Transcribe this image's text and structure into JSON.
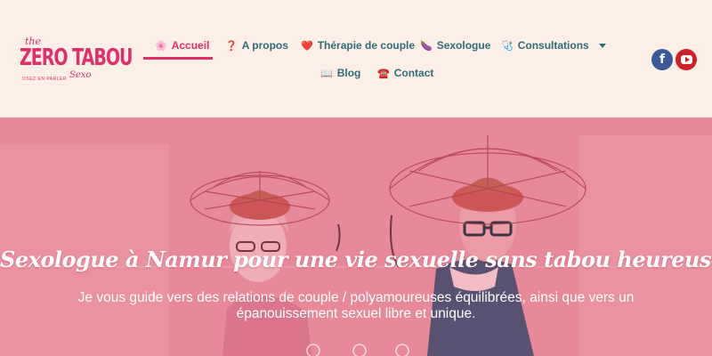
{
  "logo": {
    "small_word": "the",
    "main_word": "ZERO TABOU",
    "tagline": "OSEZ EN PARLER",
    "script_word": "Sexo"
  },
  "nav": {
    "items": [
      {
        "emoji": "🌸",
        "label": "Accueil",
        "active": true
      },
      {
        "emoji": "❓",
        "label": "A propos"
      },
      {
        "emoji": "❤️",
        "label": "Thérapie de couple"
      },
      {
        "emoji": "🍆",
        "label": "Sexologue"
      },
      {
        "emoji": "🩺",
        "label": "Consultations",
        "has_dropdown": true
      },
      {
        "emoji": "📖",
        "label": "Blog"
      },
      {
        "emoji": "☎️",
        "label": "Contact"
      }
    ]
  },
  "social": {
    "facebook_icon": "facebook-icon",
    "youtube_icon": "youtube-icon",
    "facebook_glyph": "f"
  },
  "hero": {
    "title": "Sexologue à Namur pour une vie sexuelle sans tabou heureuse épanouie",
    "subtitle": "Je vous guide vers des relations de couple / polyamoureuses équilibrées, ainsi que vers un épanouissement sexuel libre et unique."
  },
  "colors": {
    "accent": "#e0306a",
    "nav_text": "#2f6c78",
    "header_bg": "#fcefe8",
    "hero_overlay": "#e98d9d"
  }
}
